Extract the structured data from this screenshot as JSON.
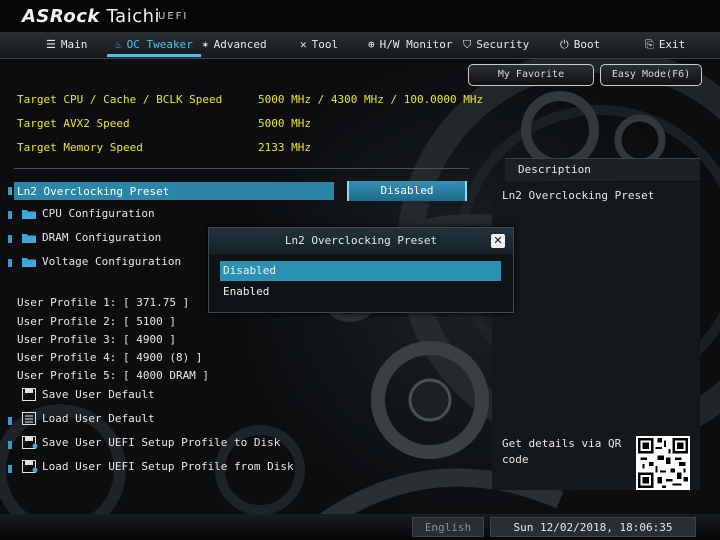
{
  "header": {
    "brand": "ASRock",
    "model": "Taichi",
    "bios": "UEFI"
  },
  "nav": {
    "tabs": [
      {
        "label": "Main",
        "icon": "list-icon"
      },
      {
        "label": "OC Tweaker",
        "icon": "flame-icon",
        "active": true
      },
      {
        "label": "Advanced",
        "icon": "star-icon"
      },
      {
        "label": "Tool",
        "icon": "tools-icon"
      },
      {
        "label": "H/W Monitor",
        "icon": "monitor-icon"
      },
      {
        "label": "Security",
        "icon": "shield-icon"
      },
      {
        "label": "Boot",
        "icon": "power-icon"
      },
      {
        "label": "Exit",
        "icon": "exit-icon"
      }
    ]
  },
  "buttons": {
    "favorite": "My Favorite",
    "easy_mode": "Easy Mode(F6)"
  },
  "targets": [
    {
      "label": "Target CPU / Cache / BCLK Speed",
      "value": "5000 MHz / 4300 MHz / 100.0000 MHz"
    },
    {
      "label": "Target AVX2 Speed",
      "value": "5000 MHz"
    },
    {
      "label": "Target Memory Speed",
      "value": "2133 MHz"
    }
  ],
  "preset": {
    "label": "Ln2 Overclocking Preset",
    "value": "Disabled"
  },
  "submenus": [
    {
      "label": "CPU Configuration",
      "icon": "folder-icon"
    },
    {
      "label": "DRAM Configuration",
      "icon": "folder-icon"
    },
    {
      "label": "Voltage Configuration",
      "icon": "folder-icon"
    }
  ],
  "profiles": [
    "User Profile 1: [ 371.75 ]",
    "User Profile 2: [ 5100 ]",
    "User Profile 3: [ 4900 ]",
    "User Profile 4: [ 4900 (8) ]",
    "User Profile 5: [ 4000 DRAM ]"
  ],
  "actions": [
    {
      "label": "Save User Default",
      "icon": "save-icon"
    },
    {
      "label": "Load User Default",
      "icon": "load-icon"
    },
    {
      "label": "Save User UEFI Setup Profile to Disk",
      "icon": "save-disk-icon"
    },
    {
      "label": "Load User UEFI Setup Profile from Disk",
      "icon": "load-disk-icon"
    }
  ],
  "description": {
    "title": "Description",
    "text": "Ln2 Overclocking Preset",
    "qr_text": "Get details via QR code"
  },
  "dialog": {
    "title": "Ln2 Overclocking Preset",
    "options": [
      "Disabled",
      "Enabled"
    ],
    "selected": "Disabled"
  },
  "footer": {
    "language": "English",
    "datetime": "Sun 12/02/2018, 18:06:35"
  },
  "colors": {
    "accent": "#2a91b4",
    "highlight_text": "#e9e623",
    "active_tab": "#3fc4f0"
  }
}
